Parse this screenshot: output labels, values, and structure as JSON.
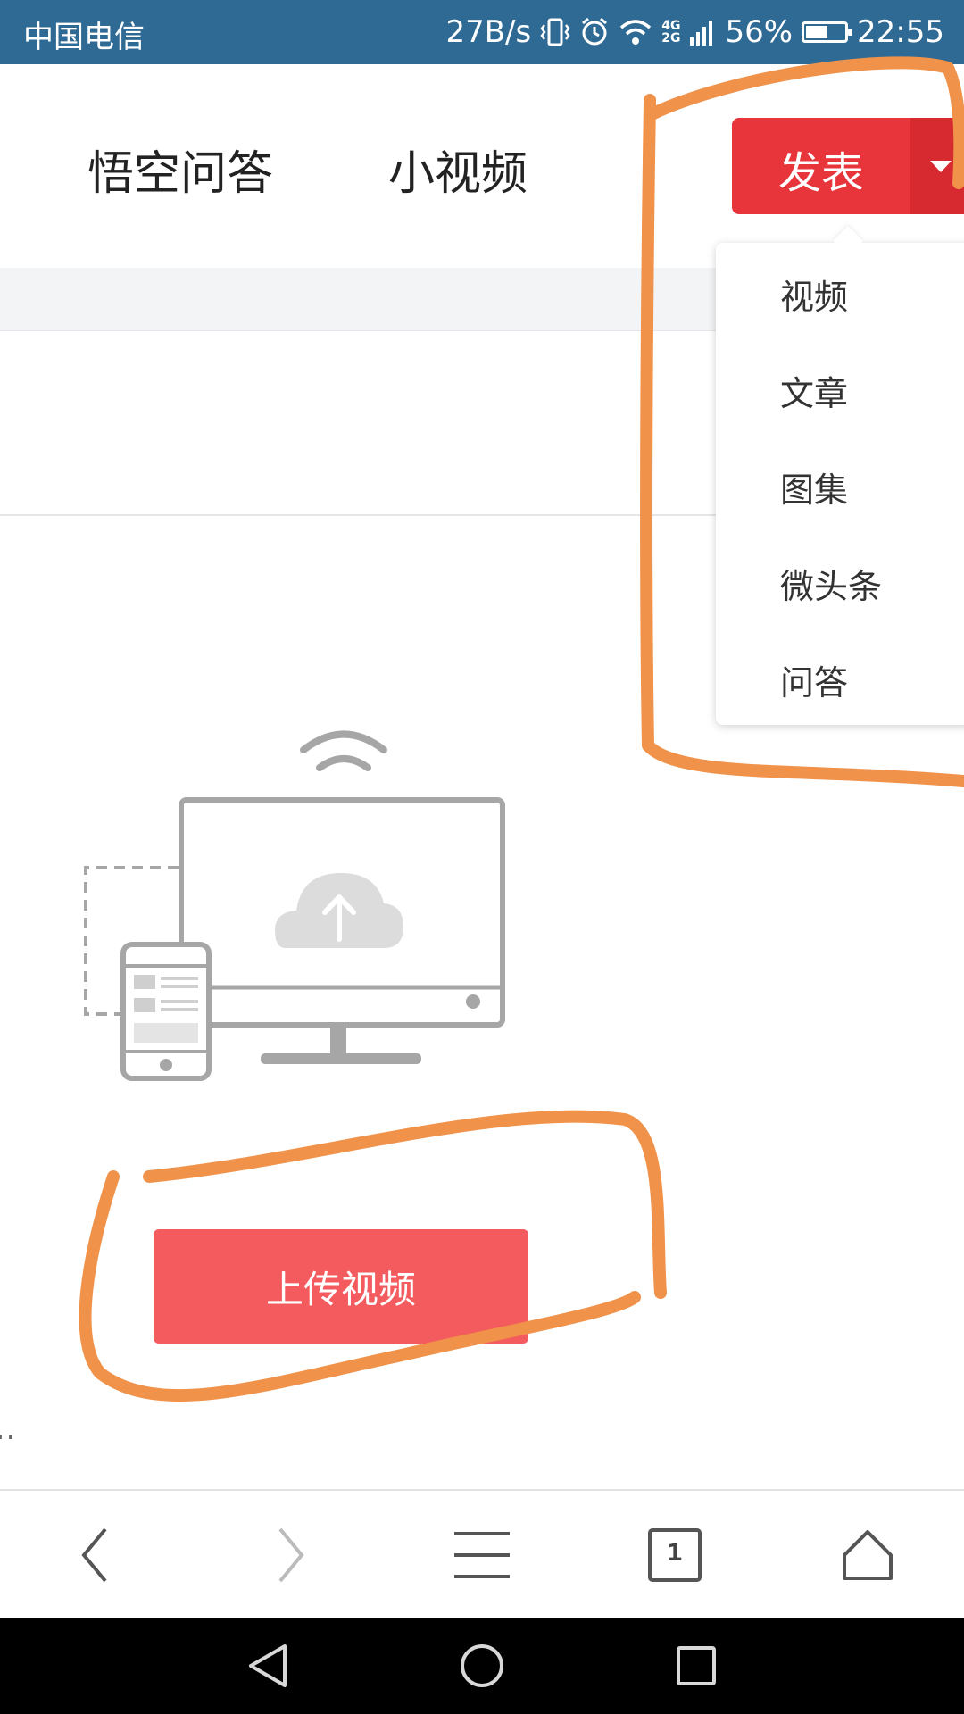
{
  "status_bar": {
    "carrier": "中国电信",
    "net_speed": "27B/s",
    "network_top": "4G",
    "network_bottom": "2G",
    "battery": "56%",
    "battery_level": 0.56,
    "time": "22:55"
  },
  "nav": {
    "tabs": [
      "悟空问答",
      "小视频"
    ]
  },
  "publish": {
    "label": "发表"
  },
  "dropdown": {
    "items": [
      "视频",
      "文章",
      "图集",
      "微头条",
      "问答"
    ]
  },
  "upload": {
    "button_label": "上传视频"
  },
  "browser_toolbar": {
    "tab_count": "1"
  },
  "colors": {
    "status_bar": "#2f6a94",
    "publish": "#e8353b",
    "upload": "#f45b5f",
    "annotation": "#f0924a"
  }
}
